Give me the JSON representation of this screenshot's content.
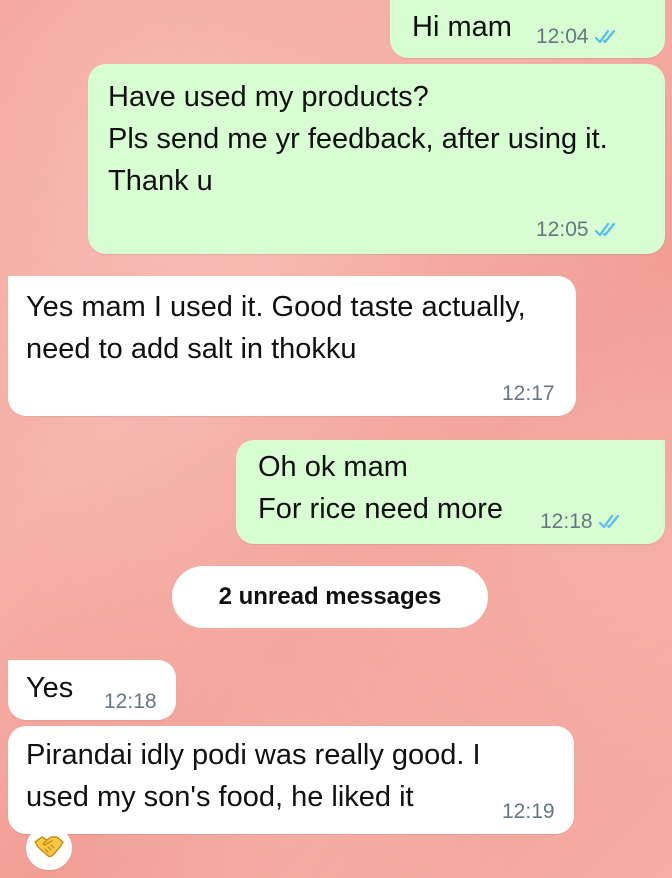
{
  "messages": [
    {
      "direction": "outgoing",
      "text": "Hi mam",
      "time": "12:04",
      "status": "read"
    },
    {
      "direction": "outgoing",
      "text": "Have used my products?\nPls send me yr feedback, after using it.\nThank u",
      "time": "12:05",
      "status": "read"
    },
    {
      "direction": "incoming",
      "text": "Yes mam I used it. Good taste actually, need to add salt in thokku",
      "time": "12:17"
    },
    {
      "direction": "outgoing",
      "text": "Oh ok mam\nFor rice need more",
      "time": "12:18",
      "status": "read"
    },
    {
      "direction": "incoming",
      "text": "Yes",
      "time": "12:18"
    },
    {
      "direction": "incoming",
      "text": "Pirandai idly podi was really good. I used my son's food, he liked it",
      "time": "12:19"
    }
  ],
  "unread_divider": "2 unread messages",
  "reaction": {
    "icon": "handshake-emoji"
  },
  "colors": {
    "outgoing_bubble": "#d9fdd3",
    "incoming_bubble": "#ffffff",
    "read_ticks": "#53bdeb",
    "timestamp": "#667781",
    "wallpaper": "#f3a097"
  }
}
